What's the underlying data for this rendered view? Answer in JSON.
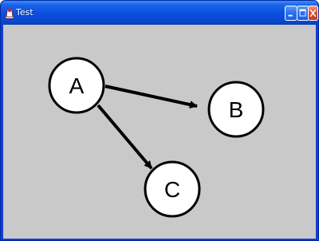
{
  "window": {
    "title": "Test",
    "app_icon": "java-duke-icon",
    "controls": [
      "minimize-icon",
      "maximize-icon",
      "close-icon"
    ]
  },
  "colors": {
    "titlebar": "#0a4fdc",
    "client_background": "#c9c9c9",
    "node_fill": "#ffffff",
    "stroke": "#000000",
    "close_button": "#de4a2a"
  },
  "graph": {
    "nodes": [
      {
        "id": "A",
        "label": "A"
      },
      {
        "id": "B",
        "label": "B"
      },
      {
        "id": "C",
        "label": "C"
      }
    ],
    "edges": [
      {
        "from": "A",
        "to": "B",
        "directed": true
      },
      {
        "from": "A",
        "to": "C",
        "directed": true
      }
    ]
  }
}
